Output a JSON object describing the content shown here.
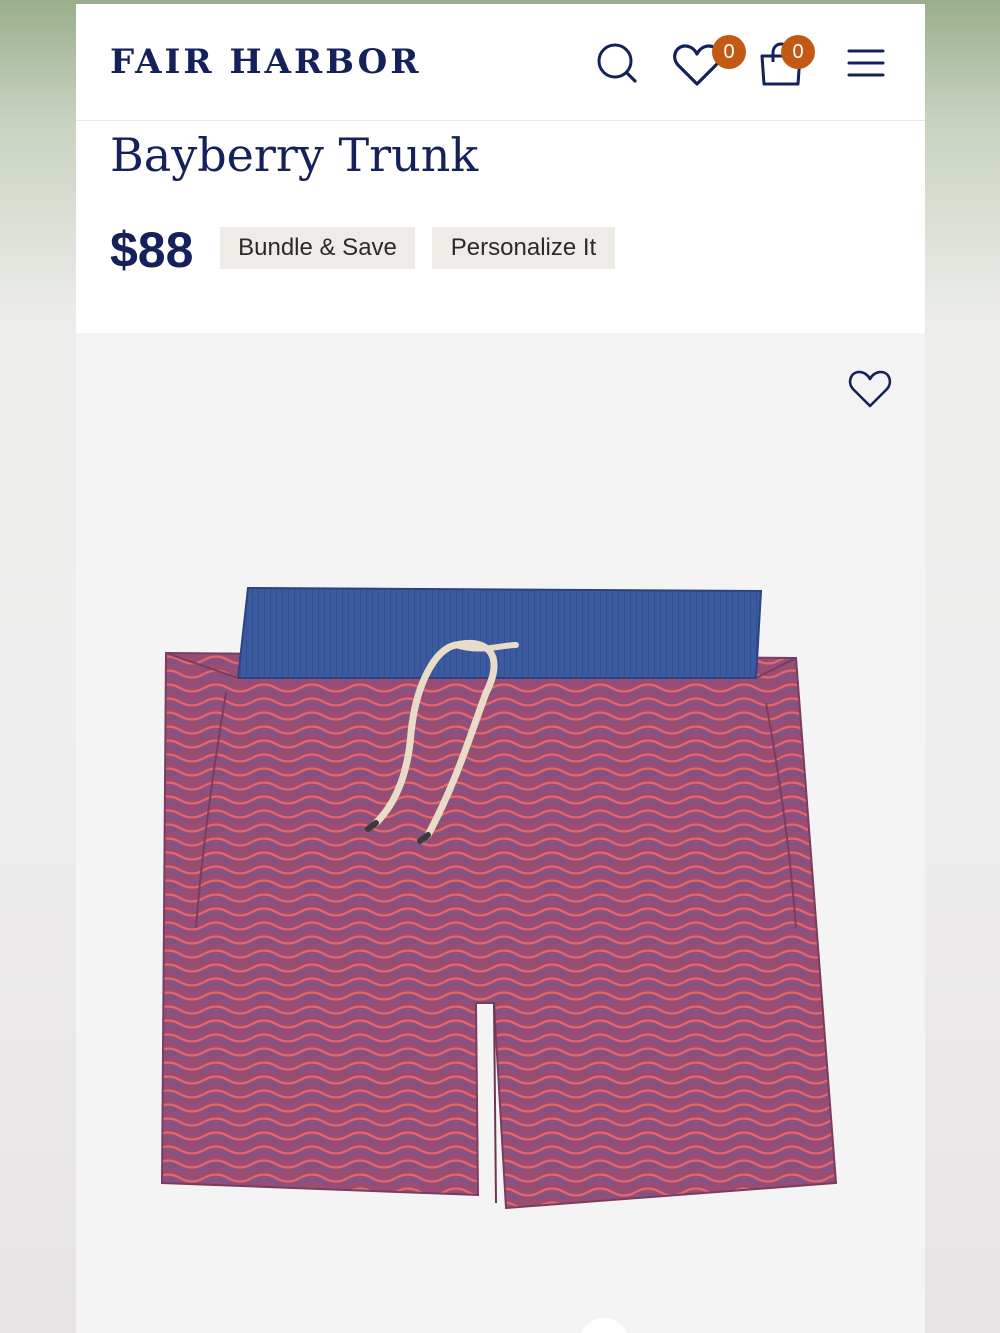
{
  "header": {
    "brand": "FAIR HARBOR",
    "icons": {
      "search": "search-icon",
      "wishlist": "heart-icon",
      "cart": "shopping-bag-icon",
      "menu": "hamburger-menu-icon"
    },
    "wishlist_count": "0",
    "cart_count": "0"
  },
  "product": {
    "name": "Bayberry Trunk",
    "price": "$88",
    "tags": [
      "Bundle & Save",
      "Personalize It"
    ],
    "favorite_icon": "heart-outline-icon"
  },
  "colors": {
    "brand_navy": "#14215a",
    "badge_orange": "#c35a14",
    "tag_background": "#efece8",
    "image_background": "#f4f4f4",
    "shorts_body": "#a8566f",
    "waistband": "#3b5aa0"
  }
}
